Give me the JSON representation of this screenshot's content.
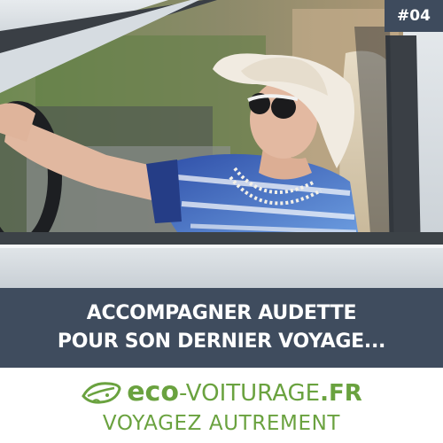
{
  "badge": {
    "text": "#04"
  },
  "headline": {
    "line1": "ACCOMPAGNER AUDETTE",
    "line2": "POUR SON DERNIER VOYAGE..."
  },
  "brand": {
    "name_eco": "eco",
    "name_rest": "-VOITURAGE",
    "name_tld": ".FR",
    "slogan": "VOYAGEZ AUTREMENT",
    "logo_icon": "leaf-icon"
  },
  "colors": {
    "banner": "#3f4c5e",
    "brand_green": "#6aa23f",
    "badge": "#3e4b5d"
  }
}
